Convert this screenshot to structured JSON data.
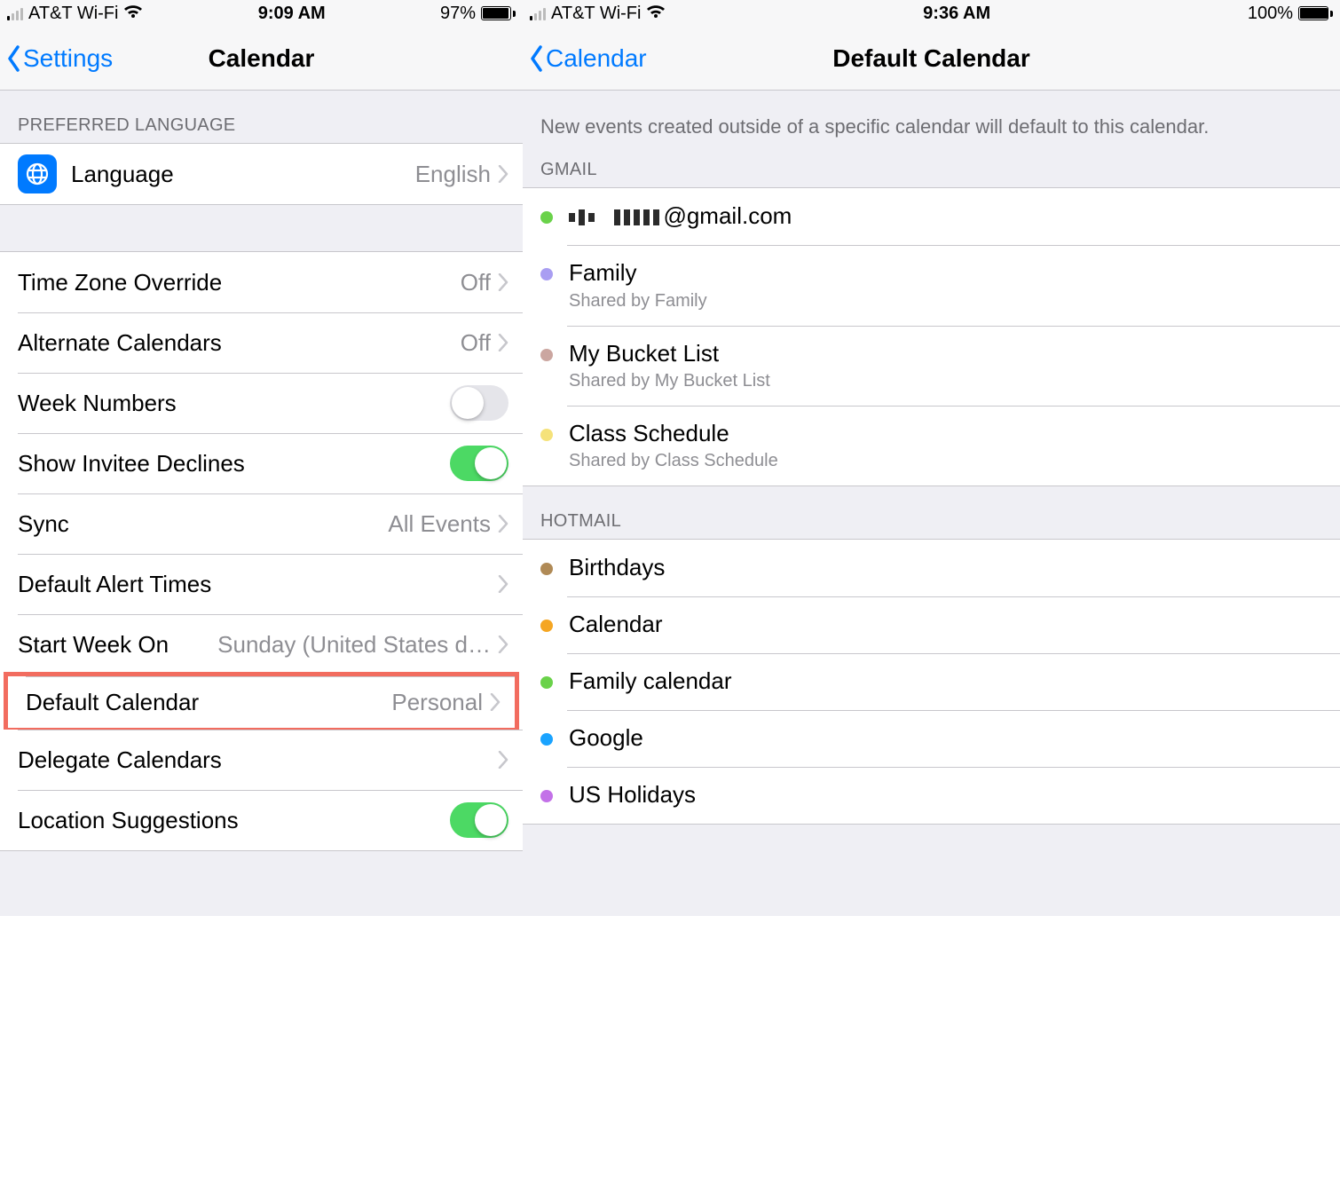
{
  "left": {
    "status": {
      "carrier": "AT&T Wi-Fi",
      "time": "9:09 AM",
      "battery_pct": "97%",
      "battery_fill": 95
    },
    "nav": {
      "back": "Settings",
      "title": "Calendar"
    },
    "section_lang_header": "PREFERRED LANGUAGE",
    "language_row": {
      "label": "Language",
      "value": "English"
    },
    "rows": {
      "tz": {
        "label": "Time Zone Override",
        "value": "Off"
      },
      "alt": {
        "label": "Alternate Calendars",
        "value": "Off"
      },
      "weeknum": {
        "label": "Week Numbers",
        "on": false
      },
      "invitee": {
        "label": "Show Invitee Declines",
        "on": true
      },
      "sync": {
        "label": "Sync",
        "value": "All Events"
      },
      "alerts": {
        "label": "Default Alert Times",
        "value": ""
      },
      "startwk": {
        "label": "Start Week On",
        "value": "Sunday (United States d…"
      },
      "defcal": {
        "label": "Default Calendar",
        "value": "Personal"
      },
      "delegate": {
        "label": "Delegate Calendars",
        "value": ""
      },
      "locsugg": {
        "label": "Location Suggestions",
        "on": true
      }
    }
  },
  "right": {
    "status": {
      "carrier": "AT&T Wi-Fi",
      "time": "9:36 AM",
      "battery_pct": "100%",
      "battery_fill": 100
    },
    "nav": {
      "back": "Calendar",
      "title": "Default Calendar"
    },
    "description": "New events created outside of a specific calendar will default to this calendar.",
    "gmail_header": "GMAIL",
    "gmail": [
      {
        "dot": "#6ad24a",
        "title_suffix": "@gmail.com",
        "sub": "",
        "redacted": true
      },
      {
        "dot": "#a99ef2",
        "title": "Family",
        "sub": "Shared by Family"
      },
      {
        "dot": "#cba6a0",
        "title": "My Bucket List",
        "sub": "Shared by My Bucket List"
      },
      {
        "dot": "#f5e27a",
        "title": "Class Schedule",
        "sub": "Shared by Class Schedule"
      }
    ],
    "hotmail_header": "HOTMAIL",
    "hotmail": [
      {
        "dot": "#b08a56",
        "title": "Birthdays"
      },
      {
        "dot": "#f5a623",
        "title": "Calendar"
      },
      {
        "dot": "#6ad24a",
        "title": "Family calendar"
      },
      {
        "dot": "#1aa3ff",
        "title": "Google"
      },
      {
        "dot": "#c371e8",
        "title": "US Holidays"
      }
    ]
  }
}
